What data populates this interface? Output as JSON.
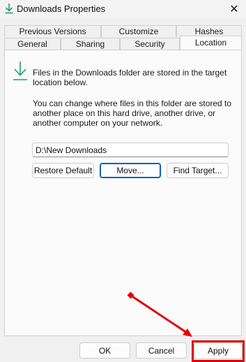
{
  "window": {
    "title": "Downloads Properties",
    "close_glyph": "✕",
    "icon": "download-icon"
  },
  "tabs": {
    "row1": [
      {
        "label": "Previous Versions"
      },
      {
        "label": "Customize"
      },
      {
        "label": "Hashes"
      }
    ],
    "row2": [
      {
        "label": "General"
      },
      {
        "label": "Sharing"
      },
      {
        "label": "Security"
      },
      {
        "label": "Location"
      }
    ],
    "active": "Location"
  },
  "location": {
    "info_text": "Files in the Downloads folder are stored in the target location below.",
    "description": "You can change where files in this folder are stored to another place on this hard drive, another drive, or another computer on your network.",
    "path_value": "D:\\New Downloads",
    "restore_label": "Restore Default",
    "move_label": "Move...",
    "find_target_label": "Find Target..."
  },
  "footer": {
    "ok_label": "OK",
    "cancel_label": "Cancel",
    "apply_label": "Apply"
  },
  "annotation": {
    "color": "#e10000",
    "target": "apply-button"
  },
  "colors": {
    "accent": "#005fb8",
    "download_icon": "#1b9e77"
  }
}
